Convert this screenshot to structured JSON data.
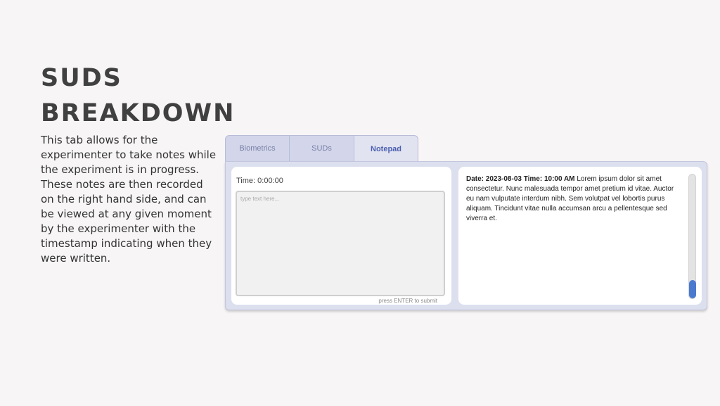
{
  "slide": {
    "title_line1": "SUDS",
    "title_line2": "BREAKDOWN",
    "description": "This tab allows for the experimenter to take notes while the experiment is in progress. These notes are then recorded on the right hand side, and can be viewed at any given moment by the experimenter with the timestamp indicating when they were written."
  },
  "tabs": [
    {
      "label": "Biometrics",
      "active": false
    },
    {
      "label": "SUDs",
      "active": false
    },
    {
      "label": "Notepad",
      "active": true
    }
  ],
  "notepad": {
    "timer": "Time: 0:00:00",
    "input_placeholder": "type text here...",
    "input_value": "",
    "hint": "press ENTER to submit"
  },
  "log": {
    "entries": [
      {
        "stamp": "Date: 2023-08-03 Time: 10:00 AM",
        "text": "Lorem ipsum dolor sit amet consectetur. Nunc malesuada tempor amet pretium id vitae. Auctor eu nam vulputate interdum nibh. Sem volutpat vel lobortis purus aliquam. Tincidunt vitae nulla accumsan arcu a pellentesque sed viverra et."
      }
    ],
    "scroll_position": 1.0
  },
  "colors": {
    "accent": "#4a5fae",
    "scroll_thumb": "#4a7ad0",
    "panel_bg": "#dcdfee"
  }
}
